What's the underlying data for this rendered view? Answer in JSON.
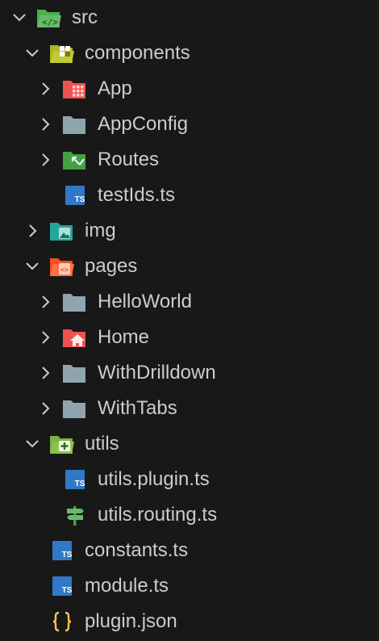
{
  "explorer": {
    "items": [
      {
        "label": "src",
        "icon": "folder-src-open-icon",
        "depth": 0,
        "expanded": true
      },
      {
        "label": "components",
        "icon": "folder-components-open-icon",
        "depth": 1,
        "expanded": true
      },
      {
        "label": "App",
        "icon": "folder-app-icon",
        "depth": 2,
        "expanded": false
      },
      {
        "label": "AppConfig",
        "icon": "folder-icon",
        "depth": 2,
        "expanded": false
      },
      {
        "label": "Routes",
        "icon": "folder-routes-icon",
        "depth": 2,
        "expanded": false
      },
      {
        "label": "testIds.ts",
        "icon": "typescript-file-icon",
        "depth": 2
      },
      {
        "label": "img",
        "icon": "folder-images-icon",
        "depth": 1,
        "expanded": false
      },
      {
        "label": "pages",
        "icon": "folder-pages-open-icon",
        "depth": 1,
        "expanded": true
      },
      {
        "label": "HelloWorld",
        "icon": "folder-icon",
        "depth": 2,
        "expanded": false
      },
      {
        "label": "Home",
        "icon": "folder-home-icon",
        "depth": 2,
        "expanded": false
      },
      {
        "label": "WithDrilldown",
        "icon": "folder-icon",
        "depth": 2,
        "expanded": false
      },
      {
        "label": "WithTabs",
        "icon": "folder-icon",
        "depth": 2,
        "expanded": false
      },
      {
        "label": "utils",
        "icon": "folder-utils-open-icon",
        "depth": 1,
        "expanded": true
      },
      {
        "label": "utils.plugin.ts",
        "icon": "typescript-file-icon",
        "depth": 2
      },
      {
        "label": "utils.routing.ts",
        "icon": "routing-file-icon",
        "depth": 2
      },
      {
        "label": "constants.ts",
        "icon": "typescript-file-icon",
        "depth": 1
      },
      {
        "label": "module.ts",
        "icon": "typescript-file-icon",
        "depth": 1
      },
      {
        "label": "plugin.json",
        "icon": "json-file-icon",
        "depth": 1
      }
    ]
  },
  "colors": {
    "background": "#181818",
    "text": "#cccccc",
    "chevron": "#cccccc",
    "folder_gray": "#90a4ae",
    "folder_green": "#4caf50",
    "folder_yellow": "#c0ca33",
    "folder_red": "#ef5350",
    "folder_teal": "#26a69a",
    "folder_orange": "#ff7043",
    "typescript_blue": "#3178c6",
    "json_yellow": "#f9c74f"
  }
}
